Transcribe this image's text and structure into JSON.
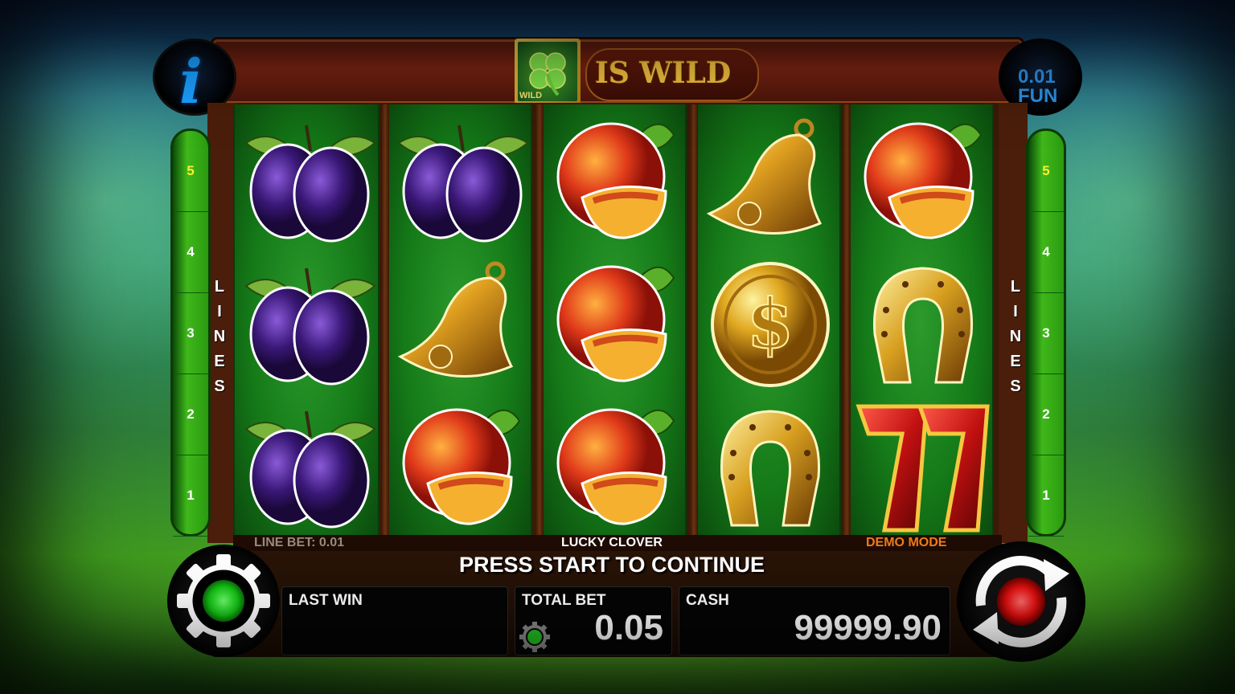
{
  "banner": {
    "wild_badge_label": "WILD",
    "wild_text": "IS WILD"
  },
  "denomination": {
    "value": "0.01",
    "currency": "FUN"
  },
  "info_button": {
    "glyph": "i"
  },
  "lines_panel": {
    "label_letters": [
      "L",
      "I",
      "N",
      "E",
      "S"
    ],
    "numbers": [
      "5",
      "4",
      "3",
      "2",
      "1"
    ],
    "active": "5"
  },
  "reels": [
    [
      "plum",
      "plum",
      "plum"
    ],
    [
      "plum",
      "bell",
      "peach"
    ],
    [
      "peach",
      "peach",
      "peach"
    ],
    [
      "bell",
      "dollar-coin",
      "horseshoe"
    ],
    [
      "peach",
      "horseshoe",
      "seven"
    ]
  ],
  "status": {
    "line_bet": "LINE BET: 0.01",
    "game_name": "LUCKY CLOVER",
    "mode": "DEMO MODE",
    "message": "PRESS START TO CONTINUE"
  },
  "fields": {
    "last_win_label": "LAST WIN",
    "last_win_value": "",
    "total_bet_label": "TOTAL BET",
    "total_bet_value": "0.05",
    "cash_label": "CASH",
    "cash_value": "99999.90"
  },
  "colors": {
    "line_active": "#f8f030",
    "demo_mode": "#f07a1a",
    "info_blue": "#1aa0ff",
    "spin_red": "#e01010",
    "settings_green": "#12d012"
  }
}
